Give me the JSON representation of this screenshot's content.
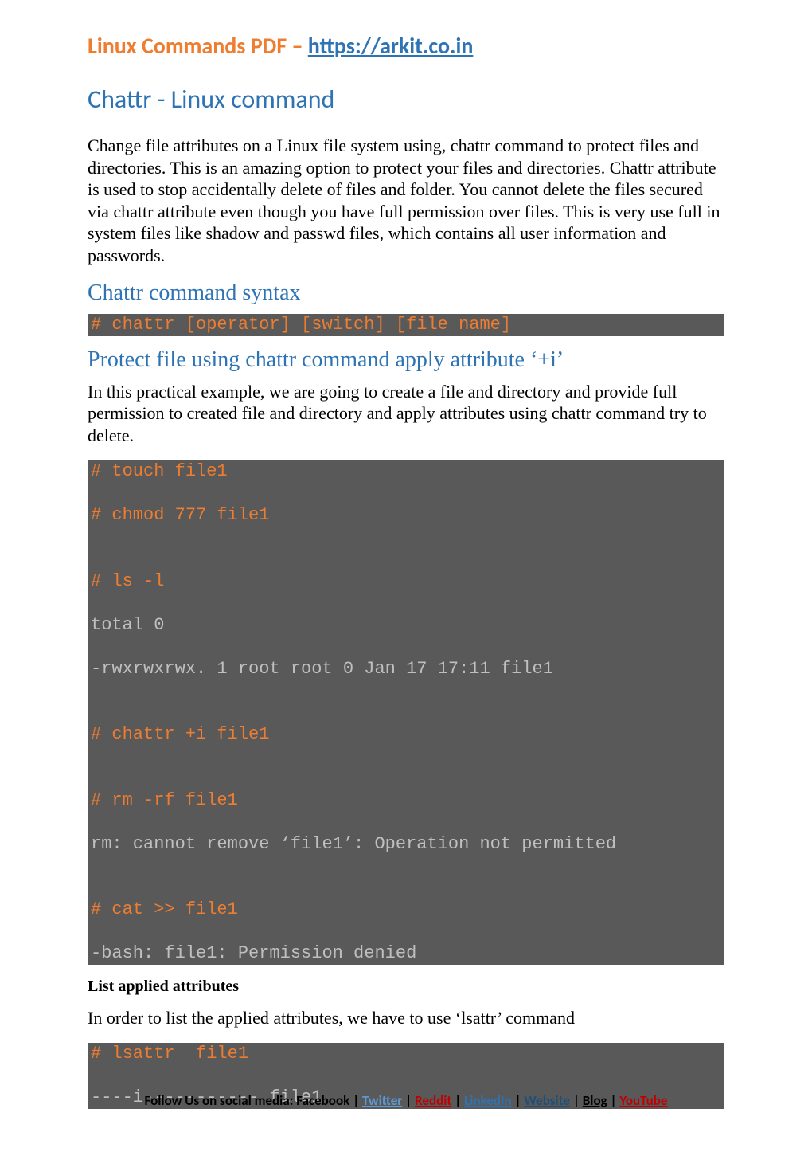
{
  "header": {
    "prefix": "Linux Commands PDF – ",
    "link_text": "https://arkit.co.in"
  },
  "title": "Chattr - Linux command",
  "intro": "Change file attributes on a Linux file system using, chattr command to protect files and directories.  This is an amazing option to protect your files and directories. Chattr attribute is used to stop accidentally delete of files and folder. You cannot delete the files secured via chattr attribute even though you have full permission over files. This is very use full in system files like shadow and passwd files, which contains all user information and passwords.",
  "syntax_title": "Chattr command syntax",
  "syntax_code": "# chattr [operator] [switch] [file name]",
  "protect_title": "Protect file using chattr command apply attribute ‘+i’",
  "protect_intro": "In this practical example, we are going to create a file and directory and provide full permission to created file and directory and apply attributes using chattr command try to delete.",
  "code1": {
    "l1": "# touch file1",
    "l2": "# chmod 777 file1",
    "l3_blank": "",
    "l4": "# ls -l",
    "l5": "total 0",
    "l6": "-rwxrwxrwx. 1 root root 0 Jan 17 17:11 file1",
    "l7_blank": "",
    "l8": "# chattr +i file1",
    "l9_blank": "",
    "l10": "# rm -rf file1",
    "l11": "rm: cannot remove ‘file1’: Operation not permitted",
    "l12_blank": "",
    "l13": "# cat >> file1",
    "l14": "-bash: file1: Permission denied"
  },
  "list_applied_title": "List applied attributes",
  "list_applied_text": "In order to list the applied attributes, we have to use ‘lsattr’ command",
  "code2": {
    "l1": "# lsattr  file1",
    "l2": "----i----------- file1"
  },
  "footer": {
    "prefix": "Follow Us on social media:  Facebook",
    "twitter": "Twitter",
    "reddit": "Reddit",
    "linkedin": "LinkedIn",
    "website": "Website",
    "blog": "Blog",
    "youtube": "YouTube"
  }
}
